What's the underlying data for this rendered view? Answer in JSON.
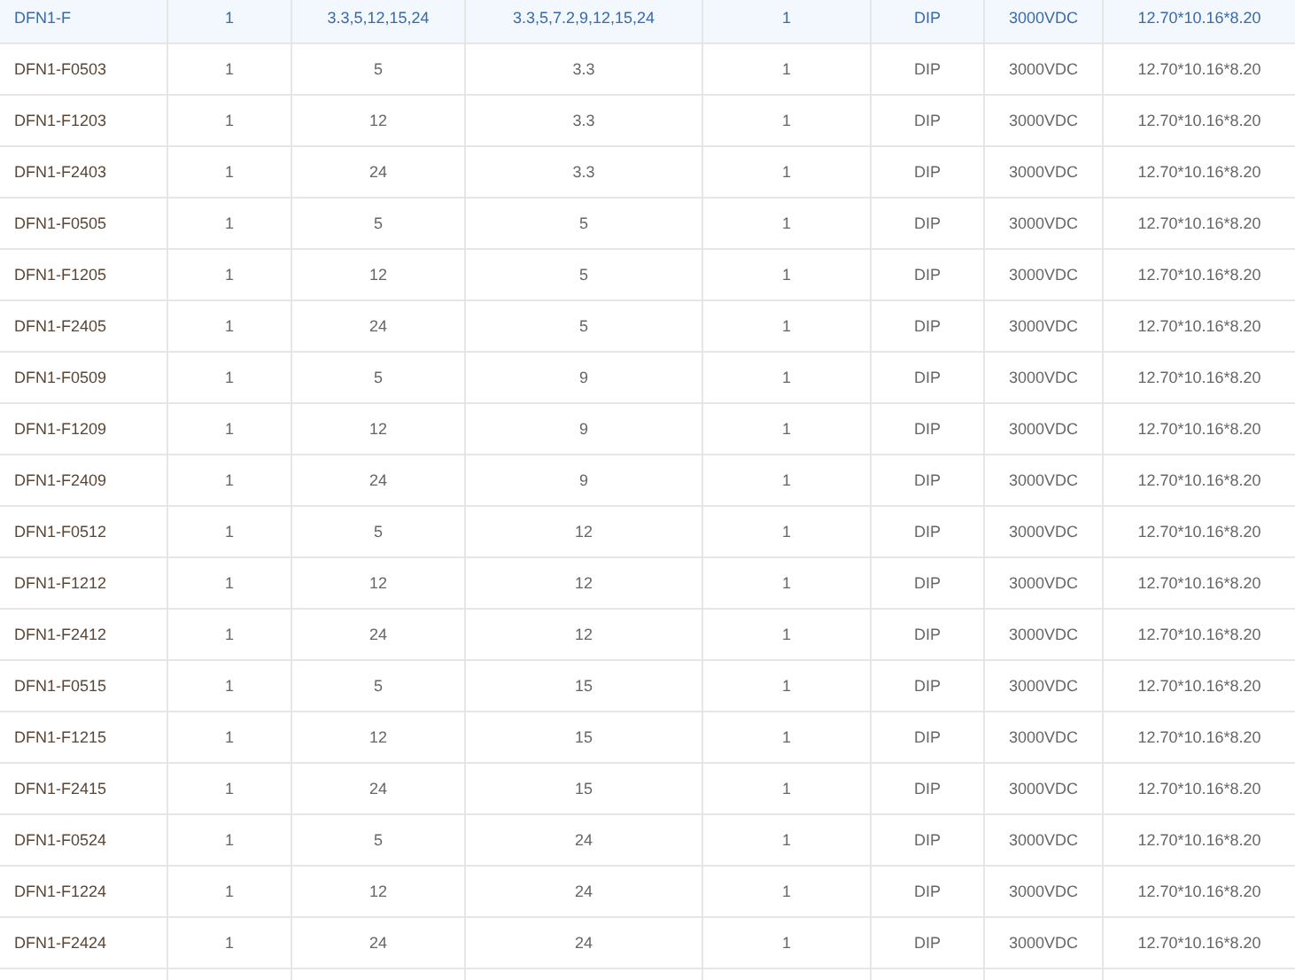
{
  "table": {
    "rows": [
      {
        "selected": true,
        "cells": [
          "DFN1-F",
          "1",
          "3.3,5,12,15,24",
          "3.3,5,7.2,9,12,15,24",
          "1",
          "DIP",
          "3000VDC",
          "12.70*10.16*8.20"
        ]
      },
      {
        "selected": false,
        "cells": [
          "DFN1-F0503",
          "1",
          "5",
          "3.3",
          "1",
          "DIP",
          "3000VDC",
          "12.70*10.16*8.20"
        ]
      },
      {
        "selected": false,
        "cells": [
          "DFN1-F1203",
          "1",
          "12",
          "3.3",
          "1",
          "DIP",
          "3000VDC",
          "12.70*10.16*8.20"
        ]
      },
      {
        "selected": false,
        "cells": [
          "DFN1-F2403",
          "1",
          "24",
          "3.3",
          "1",
          "DIP",
          "3000VDC",
          "12.70*10.16*8.20"
        ]
      },
      {
        "selected": false,
        "cells": [
          "DFN1-F0505",
          "1",
          "5",
          "5",
          "1",
          "DIP",
          "3000VDC",
          "12.70*10.16*8.20"
        ]
      },
      {
        "selected": false,
        "cells": [
          "DFN1-F1205",
          "1",
          "12",
          "5",
          "1",
          "DIP",
          "3000VDC",
          "12.70*10.16*8.20"
        ]
      },
      {
        "selected": false,
        "cells": [
          "DFN1-F2405",
          "1",
          "24",
          "5",
          "1",
          "DIP",
          "3000VDC",
          "12.70*10.16*8.20"
        ]
      },
      {
        "selected": false,
        "cells": [
          "DFN1-F0509",
          "1",
          "5",
          "9",
          "1",
          "DIP",
          "3000VDC",
          "12.70*10.16*8.20"
        ]
      },
      {
        "selected": false,
        "cells": [
          "DFN1-F1209",
          "1",
          "12",
          "9",
          "1",
          "DIP",
          "3000VDC",
          "12.70*10.16*8.20"
        ]
      },
      {
        "selected": false,
        "cells": [
          "DFN1-F2409",
          "1",
          "24",
          "9",
          "1",
          "DIP",
          "3000VDC",
          "12.70*10.16*8.20"
        ]
      },
      {
        "selected": false,
        "cells": [
          "DFN1-F0512",
          "1",
          "5",
          "12",
          "1",
          "DIP",
          "3000VDC",
          "12.70*10.16*8.20"
        ]
      },
      {
        "selected": false,
        "cells": [
          "DFN1-F1212",
          "1",
          "12",
          "12",
          "1",
          "DIP",
          "3000VDC",
          "12.70*10.16*8.20"
        ]
      },
      {
        "selected": false,
        "cells": [
          "DFN1-F2412",
          "1",
          "24",
          "12",
          "1",
          "DIP",
          "3000VDC",
          "12.70*10.16*8.20"
        ]
      },
      {
        "selected": false,
        "cells": [
          "DFN1-F0515",
          "1",
          "5",
          "15",
          "1",
          "DIP",
          "3000VDC",
          "12.70*10.16*8.20"
        ]
      },
      {
        "selected": false,
        "cells": [
          "DFN1-F1215",
          "1",
          "12",
          "15",
          "1",
          "DIP",
          "3000VDC",
          "12.70*10.16*8.20"
        ]
      },
      {
        "selected": false,
        "cells": [
          "DFN1-F2415",
          "1",
          "24",
          "15",
          "1",
          "DIP",
          "3000VDC",
          "12.70*10.16*8.20"
        ]
      },
      {
        "selected": false,
        "cells": [
          "DFN1-F0524",
          "1",
          "5",
          "24",
          "1",
          "DIP",
          "3000VDC",
          "12.70*10.16*8.20"
        ]
      },
      {
        "selected": false,
        "cells": [
          "DFN1-F1224",
          "1",
          "12",
          "24",
          "1",
          "DIP",
          "3000VDC",
          "12.70*10.16*8.20"
        ]
      },
      {
        "selected": false,
        "cells": [
          "DFN1-F2424",
          "1",
          "24",
          "24",
          "1",
          "DIP",
          "3000VDC",
          "12.70*10.16*8.20"
        ]
      }
    ]
  }
}
